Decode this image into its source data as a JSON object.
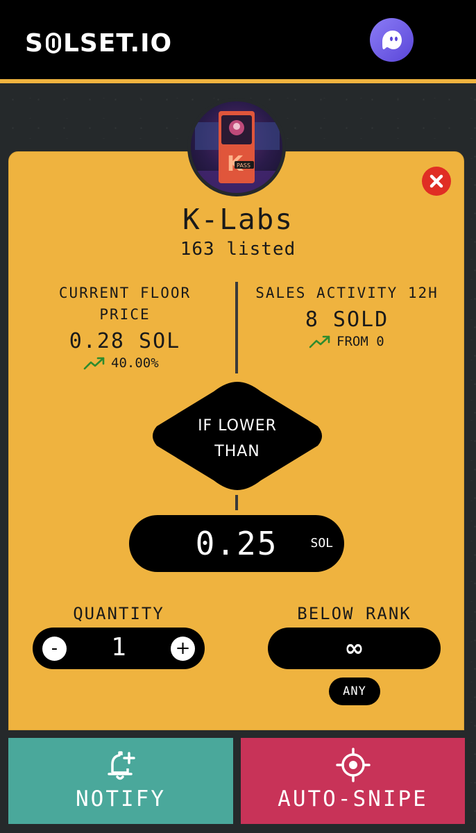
{
  "header": {
    "logo": {
      "pre": "S",
      "post": "LSET.IO"
    },
    "wallet_icon": "phantom-ghost-icon"
  },
  "collection": {
    "name": "K-Labs",
    "listed": "163 listed",
    "avatar_badge": "PASS"
  },
  "stats": {
    "floor": {
      "label_line1": "CURRENT FLOOR",
      "label_line2": "PRICE",
      "value": "0.28 SOL",
      "change": "40.00%",
      "trend_icon": "trending-up-icon"
    },
    "sales": {
      "label": "SALES ACTIVITY 12H",
      "value": "8 SOLD",
      "change": "FROM 0",
      "trend_icon": "trending-up-icon"
    }
  },
  "condition": {
    "line1": "IF LOWER",
    "line2": "THAN"
  },
  "price_input": {
    "value": "0.25",
    "unit": "SOL"
  },
  "quantity": {
    "label": "QUANTITY",
    "value": "1",
    "minus": "-",
    "plus": "+"
  },
  "rank": {
    "label": "BELOW RANK",
    "value": "∞",
    "any": "ANY"
  },
  "actions": {
    "notify": "NOTIFY",
    "autosnipe": "AUTO-SNIPE"
  },
  "colors": {
    "accent": "#efb33f",
    "notify": "#4aa89b",
    "snipe": "#c83358",
    "close": "#e02e24",
    "trend": "#2e8b2e"
  }
}
